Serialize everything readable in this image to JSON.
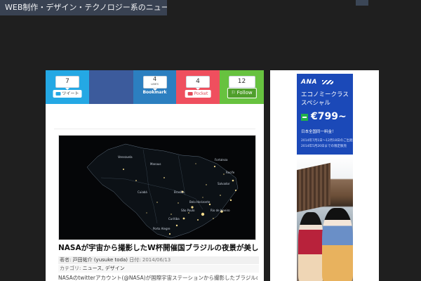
{
  "site": {
    "title": "WEB制作・デザイン・テクノロジー系のニュースとノウハウのブログ"
  },
  "share_bar": {
    "twitter": {
      "count": "7",
      "label": "ツイート"
    },
    "hatena": {
      "count": "4",
      "sub": "users",
      "label": "Bookmark"
    },
    "pocket": {
      "count": "4",
      "label": "Pocket"
    },
    "feedly": {
      "count": "12",
      "label": "Follow"
    },
    "colors": {
      "twitter": "#24a8e4",
      "facebook": "#3c5b9c",
      "hatena": "#2c7fc0",
      "pocket": "#ef4f5e",
      "feedly": "#67c23f"
    }
  },
  "article": {
    "image_places": {
      "venezuela": "Venezuela",
      "fortaleza": "Fortaleza",
      "manaus": "Manaus",
      "recife": "Recife",
      "cuiaba": "Cuiabá",
      "brasilia": "Brasília",
      "salvador": "Salvador",
      "belo": "Belo Horizonte",
      "saopaulo": "São Paulo",
      "rio": "Rio de Janeiro",
      "curitiba": "Curitiba",
      "porto": "Porto Alegre"
    },
    "title": "NASAが宇宙から撮影したW杯開催国ブラジルの夜景が美しすぎる",
    "meta_author_label": "著者:",
    "meta_author": "戸田祐介 (yusuke toda)",
    "meta_date_label": "日付:",
    "meta_date": "2014/06/13",
    "meta_category_label": "カテゴリ:",
    "meta_categories": "ニュース, デザイン",
    "excerpt": "NASAのtwitterアカウント(@NASA)が国際宇宙ステーションから撮影したブラジルの夜景写真をtwitterで公開しました"
  },
  "sidebar": {
    "ad_ana": {
      "brand": "ANA",
      "line1": "エコノミークラス",
      "line2": "スペシャル",
      "price": "€799~",
      "line3": "日本全国同一料金！",
      "line4": "2014年7月1日～12月18日のご出発",
      "line5": "2014年5月20日までの限定販売"
    }
  }
}
